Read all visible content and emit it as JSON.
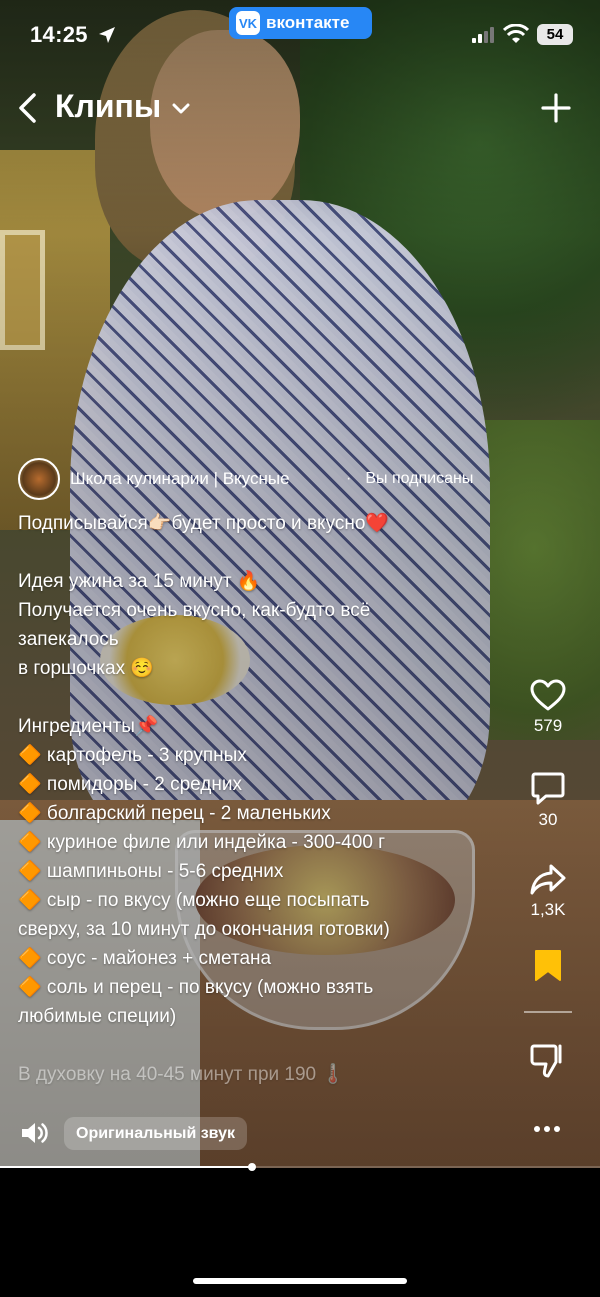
{
  "status_bar": {
    "time": "14:25",
    "app_badge": "вконтакте",
    "battery": "54"
  },
  "header": {
    "title": "Клипы"
  },
  "author": {
    "name": "Школа кулинарии | Вкусные",
    "separator": "·",
    "subscription": "Вы подписаны"
  },
  "description": {
    "lines": [
      "Подписывайся👉🏻будет просто и вкусно❤️",
      "",
      "Идея ужина за 15 минут 🔥",
      "Получается очень вкусно, как-будто всё",
      "запекалось",
      "в горшочках ☺️",
      "",
      "Ингредиенты📌",
      "🔶 картофель - 3 крупных",
      "🔶 помидоры - 2 средних",
      "🔶 болгарский перец - 2 маленьких",
      "🔶 куриное филе или индейка - 300-400 г",
      "🔶 шампиньоны - 5-6 средних",
      "🔶 сыр - по вкусу (можно еще посыпать",
      "сверху, за 10 минут до окончания готовки)",
      "🔶 соус - майонез + сметана",
      "🔶 соль и перец - по вкусу (можно взять",
      "любимые специи)",
      "",
      "В духовку на 40-45 минут при 190 🌡️"
    ]
  },
  "actions": {
    "likes": "579",
    "comments": "30",
    "shares": "1,3K"
  },
  "sound": {
    "label": "Оригинальный звук"
  },
  "progress": {
    "fraction": 0.42
  },
  "colors": {
    "vk_blue": "#2787f5",
    "bookmark": "#ffc107"
  }
}
